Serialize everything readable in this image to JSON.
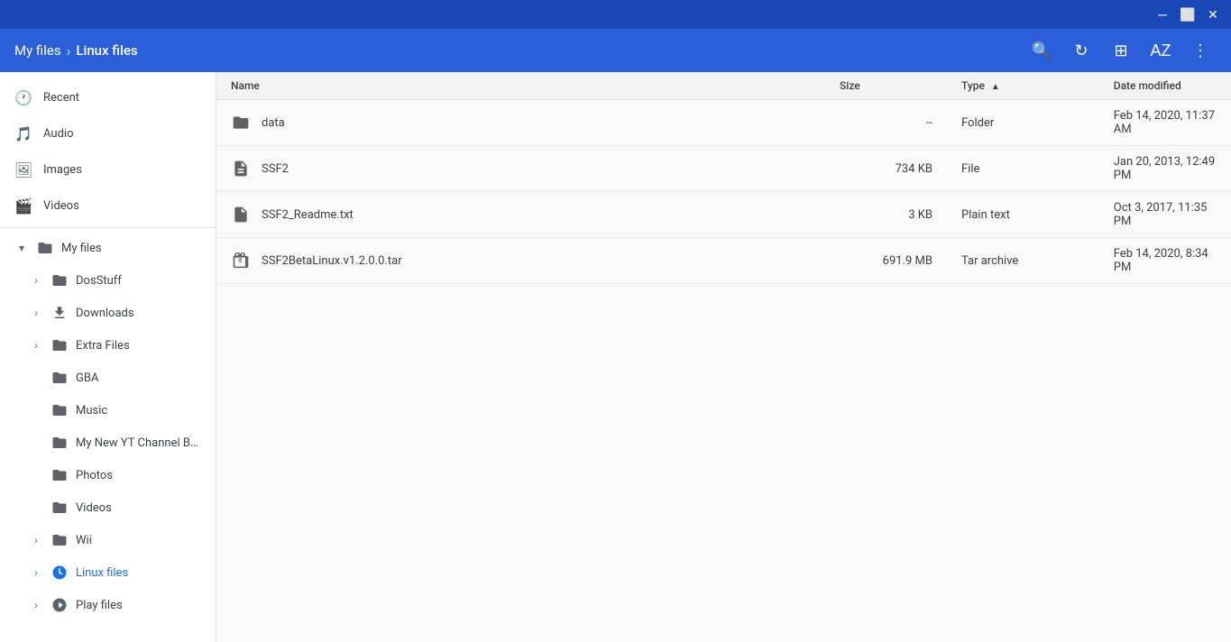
{
  "titlebar": {
    "minimize_label": "─",
    "maximize_label": "⬜",
    "close_label": "✕"
  },
  "header": {
    "breadcrumb": {
      "root": "My files",
      "separator": "›",
      "current": "Linux files"
    },
    "actions": {
      "search_label": "🔍",
      "refresh_label": "↻",
      "grid_label": "⊞",
      "sort_label": "AZ",
      "menu_label": "⋮"
    }
  },
  "sidebar": {
    "top_items": [
      {
        "id": "recent",
        "icon": "🕐",
        "label": "Recent"
      },
      {
        "id": "audio",
        "icon": "🎵",
        "label": "Audio"
      },
      {
        "id": "images",
        "icon": "🖼",
        "label": "Images"
      },
      {
        "id": "videos",
        "icon": "🎬",
        "label": "Videos"
      }
    ],
    "my_files_label": "My files",
    "tree_items": [
      {
        "id": "dosstuff",
        "label": "DosStuff",
        "indent": 1,
        "has_chevron": true,
        "expanded": false
      },
      {
        "id": "downloads",
        "label": "Downloads",
        "indent": 1,
        "has_chevron": true,
        "expanded": false
      },
      {
        "id": "extra-files",
        "label": "Extra Files",
        "indent": 1,
        "has_chevron": true,
        "expanded": false
      },
      {
        "id": "gba",
        "label": "GBA",
        "indent": 2,
        "has_chevron": false,
        "expanded": false
      },
      {
        "id": "music",
        "label": "Music",
        "indent": 2,
        "has_chevron": false,
        "expanded": false
      },
      {
        "id": "my-new-yt",
        "label": "My New YT Channel Bann...",
        "indent": 2,
        "has_chevron": false,
        "expanded": false
      },
      {
        "id": "photos",
        "label": "Photos",
        "indent": 2,
        "has_chevron": false,
        "expanded": false
      },
      {
        "id": "videos2",
        "label": "Videos",
        "indent": 2,
        "has_chevron": false,
        "expanded": false
      },
      {
        "id": "wii",
        "label": "Wii",
        "indent": 1,
        "has_chevron": true,
        "expanded": false
      },
      {
        "id": "linux-files",
        "label": "Linux files",
        "indent": 1,
        "has_chevron": true,
        "expanded": true,
        "active": true
      },
      {
        "id": "play-files",
        "label": "Play files",
        "indent": 1,
        "has_chevron": true,
        "expanded": false
      }
    ]
  },
  "table": {
    "columns": [
      {
        "id": "name",
        "label": "Name",
        "sortable": true,
        "sort_active": false
      },
      {
        "id": "size",
        "label": "Size",
        "sortable": true,
        "sort_active": false
      },
      {
        "id": "type",
        "label": "Type",
        "sortable": true,
        "sort_active": true,
        "sort_dir": "asc"
      },
      {
        "id": "date",
        "label": "Date modified",
        "sortable": true,
        "sort_active": false
      }
    ],
    "rows": [
      {
        "id": "data-folder",
        "name": "data",
        "icon": "folder",
        "size": "--",
        "type": "Folder",
        "date": "Feb 14, 2020, 11:37 AM"
      },
      {
        "id": "ssf2-file",
        "name": "SSF2",
        "icon": "file",
        "size": "734 KB",
        "type": "File",
        "date": "Jan 20, 2013, 12:49 PM"
      },
      {
        "id": "ssf2-readme",
        "name": "SSF2_Readme.txt",
        "icon": "text-file",
        "size": "3 KB",
        "type": "Plain text",
        "date": "Oct 3, 2017, 11:35 PM"
      },
      {
        "id": "ssf2-tar",
        "name": "SSF2BetaLinux.v1.2.0.0.tar",
        "icon": "archive",
        "size": "691.9 MB",
        "type": "Tar archive",
        "date": "Feb 14, 2020, 8:34 PM"
      }
    ]
  }
}
